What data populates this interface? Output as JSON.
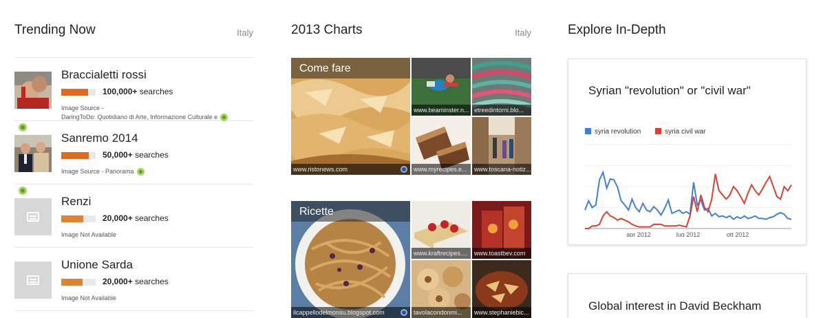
{
  "trending": {
    "title": "Trending Now",
    "region": "Italy",
    "items": [
      {
        "title": "Braccialetti rossi",
        "count": "100,000+",
        "suffix": "searches",
        "fill": 0.78,
        "source_line1": "Image Source -",
        "source_line2": "DaringToDo: Quotidiano di Arte, Informazione Culturale e"
      },
      {
        "title": "Sanremo 2014",
        "count": "50,000+",
        "suffix": "searches",
        "fill": 0.8,
        "source_line1": "Image Source - Panorama"
      },
      {
        "title": "Renzi",
        "count": "20,000+",
        "suffix": "searches",
        "fill": 0.64,
        "source_line1": "Image Not Available"
      },
      {
        "title": "Unione Sarda",
        "count": "20,000+",
        "suffix": "searches",
        "fill": 0.62,
        "source_line1": "Image Not Available"
      }
    ]
  },
  "charts": {
    "title": "2013 Charts",
    "region": "Italy",
    "grids": [
      {
        "label": "Come fare",
        "main_source": "www.ristonews.com",
        "sources": [
          "www.beaminster.n...",
          "etreedintorni.blo...",
          "www.myrecipes.e...",
          "www.toscana-notiz..."
        ]
      },
      {
        "label": "Ricette",
        "main_source": "ilcappellodelmonsu.blogspot.com",
        "sources": [
          "www.kraftrecipes....",
          "www.toastbev.com",
          "tavolacondonmi...",
          "www.stephaniebic..."
        ]
      }
    ]
  },
  "explore": {
    "title": "Explore In-Depth",
    "cards": [
      {
        "title": "Syrian \"revolution\" or \"civil war\""
      },
      {
        "title": "Global interest in David Beckham"
      }
    ]
  },
  "chart_data": {
    "type": "line",
    "title": "Syrian \"revolution\" or \"civil war\"",
    "x_tick_labels": [
      "apr 2012",
      "lug 2012",
      "ott 2012"
    ],
    "series": [
      {
        "name": "syria revolution",
        "color": "#3f7fdc",
        "values": [
          22,
          33,
          25,
          28,
          58,
          67,
          48,
          59,
          58,
          49,
          33,
          28,
          22,
          35,
          25,
          20,
          30,
          22,
          20,
          26,
          22,
          16,
          24,
          34,
          18,
          20,
          22,
          18,
          20,
          17,
          55,
          28,
          34,
          22,
          24,
          15,
          18,
          14,
          15,
          13,
          15,
          11,
          14,
          12,
          15,
          12,
          13,
          15,
          12,
          12,
          11,
          13,
          14,
          17,
          19,
          17,
          12,
          11
        ]
      },
      {
        "name": "syria civil war",
        "color": "#d8412f",
        "values": [
          0,
          0,
          3,
          3,
          5,
          15,
          20,
          15,
          13,
          10,
          12,
          10,
          8,
          5,
          3,
          2,
          2,
          2,
          2,
          5,
          5,
          5,
          3,
          3,
          3,
          3,
          4,
          3,
          2,
          15,
          38,
          20,
          40,
          25,
          20,
          35,
          65,
          45,
          40,
          35,
          40,
          50,
          45,
          38,
          30,
          42,
          52,
          45,
          40,
          47,
          55,
          62,
          50,
          38,
          35,
          50,
          45,
          52
        ]
      },
      {
        "name": "",
        "color": "#3f7fdc",
        "values": []
      }
    ],
    "ylim": [
      0,
      100
    ],
    "grid": true,
    "legend": "top-left"
  }
}
